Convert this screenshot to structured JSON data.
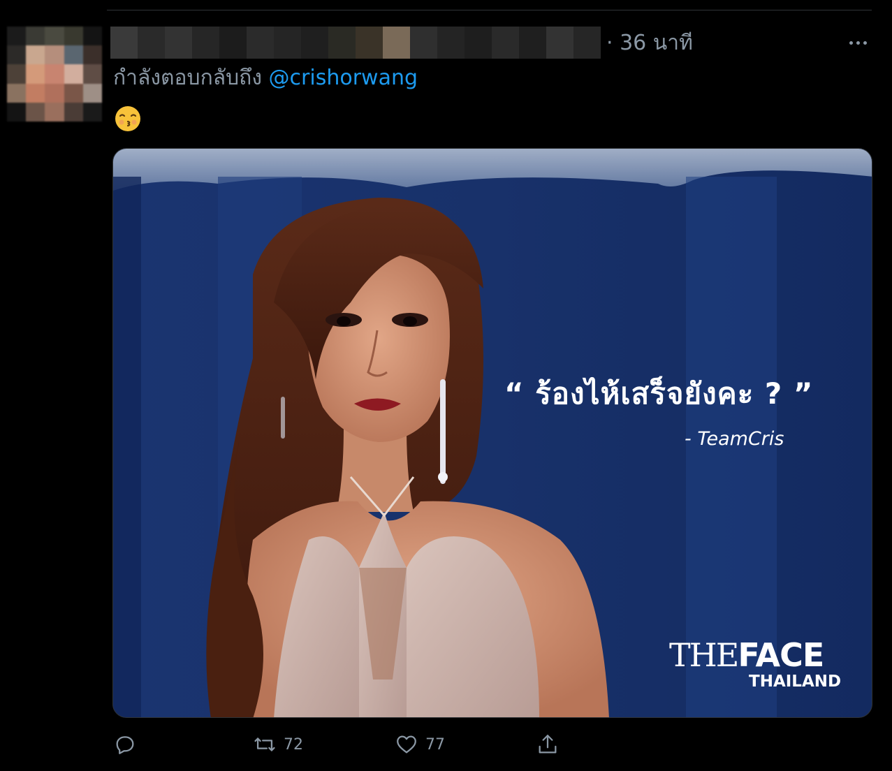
{
  "tweet": {
    "timestamp": "· 36 นาที",
    "reply_prefix": "กำลังตอบกลับถึง",
    "reply_mention": "@crishorwang",
    "emoji": "😙",
    "image": {
      "quote": "“ ร้องไห้เสร็จยังคะ ? ”",
      "quote_author": "- TeamCris",
      "logo_the": "THE",
      "logo_face": "FACE",
      "logo_sub": "THAILAND"
    }
  },
  "actions": {
    "reply_count": "",
    "retweet_count": "72",
    "like_count": "77"
  },
  "icons": {
    "more": "more-horizontal-icon",
    "reply": "reply-icon",
    "retweet": "retweet-icon",
    "like": "heart-icon",
    "share": "share-icon"
  },
  "colors": {
    "background": "#000000",
    "secondary_text": "#8b98a5",
    "mention": "#1d9bf0",
    "media_bg": "#142a5c"
  }
}
